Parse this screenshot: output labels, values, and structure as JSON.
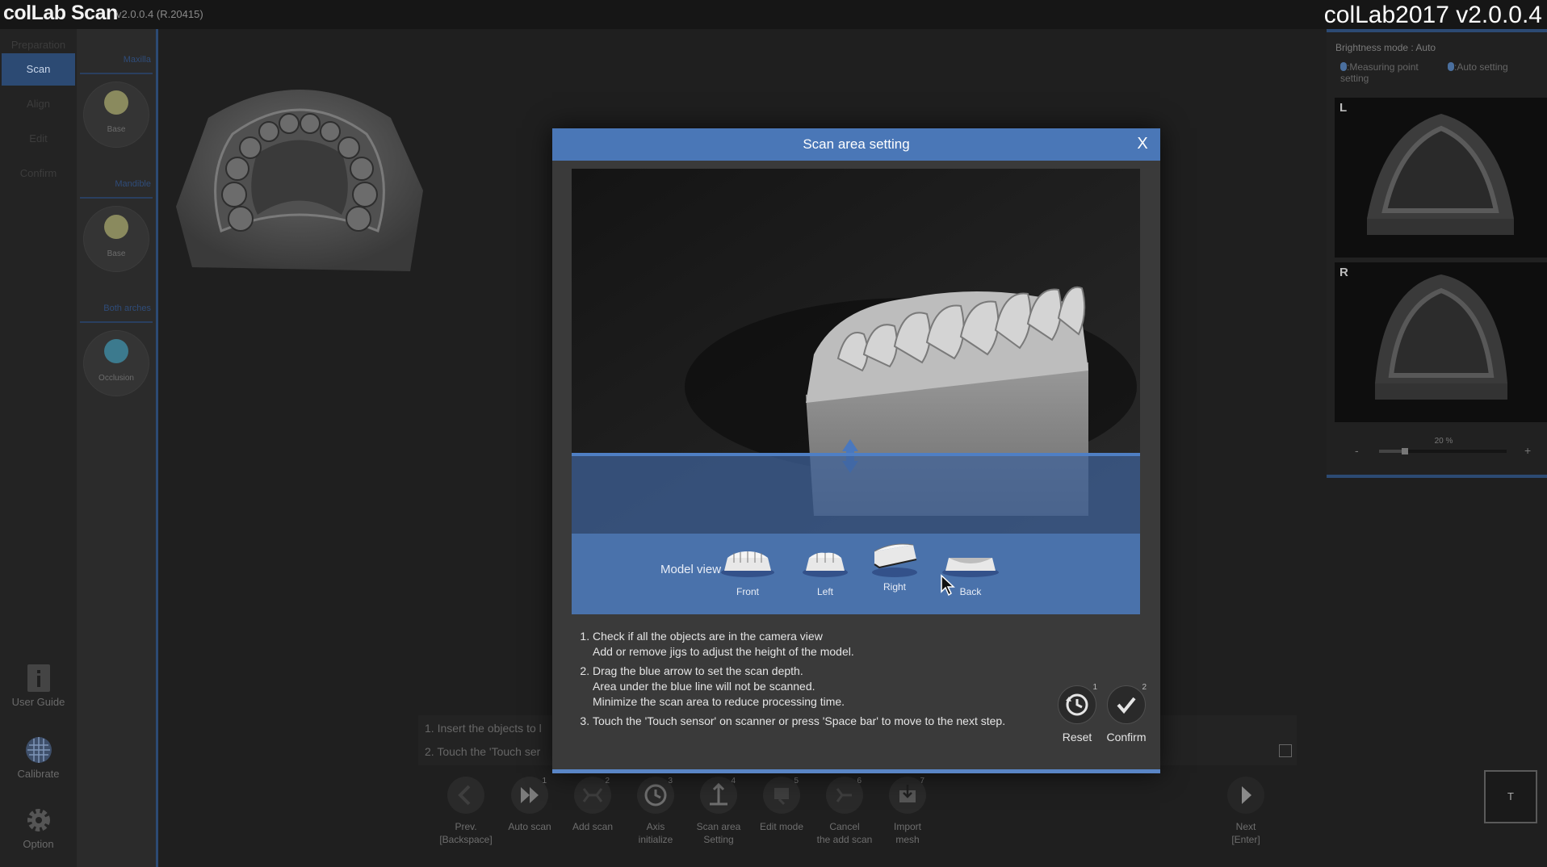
{
  "app": {
    "title": "colLab Scan",
    "version": "v2.0.0.4 (R.20415)",
    "brand_version": "colLab2017 v2.0.0.4"
  },
  "nav": {
    "items": [
      "Preparation",
      "Scan",
      "Align",
      "Edit",
      "Confirm"
    ],
    "active_index": 1
  },
  "tools": {
    "user_guide": "User Guide",
    "calibrate": "Calibrate",
    "option": "Option"
  },
  "models": {
    "maxilla": {
      "section": "Maxilla",
      "label": "Base"
    },
    "mandible": {
      "section": "Mandible",
      "label": "Base"
    },
    "both": {
      "section": "Both arches",
      "label": "Occlusion"
    }
  },
  "right_panel": {
    "brightness": "Brightness mode : Auto",
    "hint_measure": ":Measuring point setting",
    "hint_auto": ":Auto setting",
    "left_label": "L",
    "right_label": "R",
    "zoom_value": "20 %",
    "zoom_level": 0.2,
    "minus": "-",
    "plus": "+"
  },
  "bottom_msg": {
    "line1": "1. Insert the objects to l",
    "line2": "2. Touch the 'Touch ser"
  },
  "toolbar": {
    "prev": "Prev.\n[Backspace]",
    "next": "Next\n[Enter]",
    "buttons": [
      {
        "label": "Auto scan",
        "num": "1"
      },
      {
        "label": "Add scan",
        "num": "2"
      },
      {
        "label": "Axis\ninitialize",
        "num": "3"
      },
      {
        "label": "Scan area\nSetting",
        "num": "4"
      },
      {
        "label": "Edit mode",
        "num": "5"
      },
      {
        "label": "Cancel\nthe add scan",
        "num": "6"
      },
      {
        "label": "Import\nmesh",
        "num": "7"
      }
    ],
    "t_button": "T"
  },
  "dialog": {
    "title": "Scan area setting",
    "close": "X",
    "model_view_label": "Model view",
    "views": [
      "Front",
      "Left",
      "Right",
      "Back"
    ],
    "instructions": [
      {
        "main": "Check if all the objects are in the camera view",
        "sub": [
          "Add or remove jigs to adjust the height of the model."
        ]
      },
      {
        "main": "Drag the blue arrow to set the scan depth.",
        "sub": [
          "Area under the blue line will not be scanned.",
          "Minimize the scan area to reduce processing time."
        ]
      },
      {
        "main": "Touch the 'Touch sensor' on scanner or press 'Space bar' to move to the next step.",
        "sub": []
      }
    ],
    "reset": {
      "label": "Reset",
      "num": "1"
    },
    "confirm": {
      "label": "Confirm",
      "num": "2"
    }
  },
  "colors": {
    "accent": "#4a77b7",
    "nav_active": "#2c4a73",
    "maxilla_dot": "#8a8a5e",
    "mandible_dot": "#8a8a5e",
    "occlusion_dot": "#3c7a8e"
  }
}
